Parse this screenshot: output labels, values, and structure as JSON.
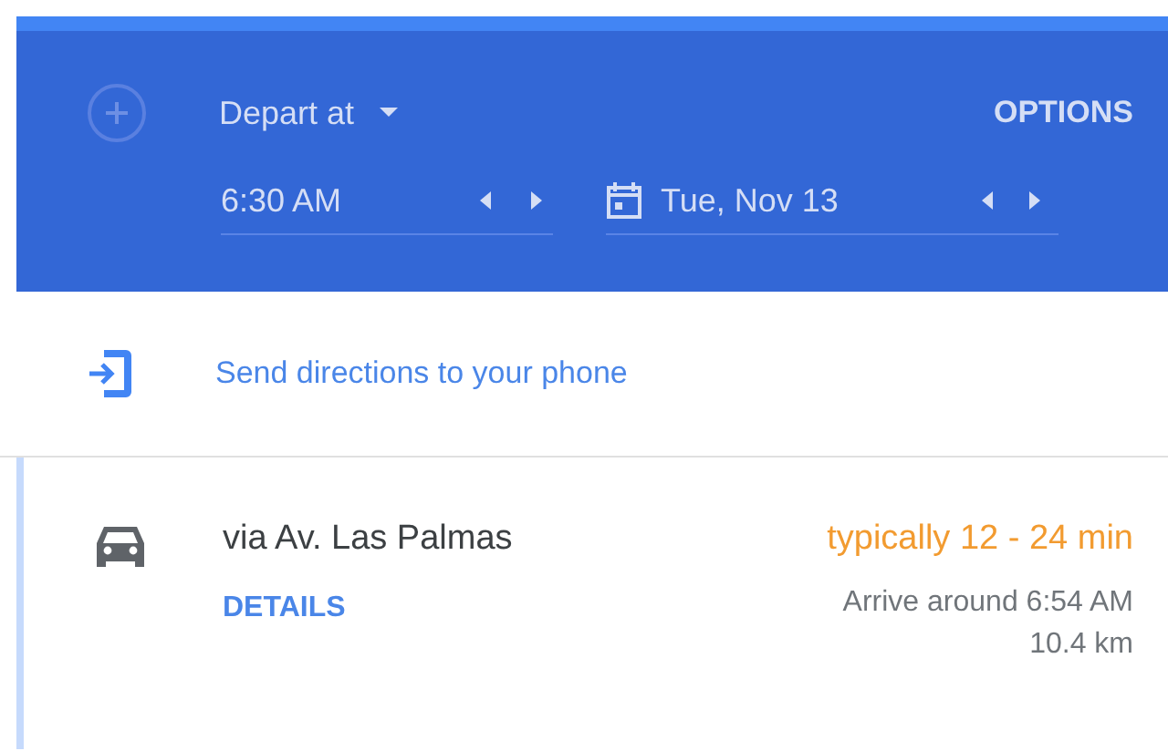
{
  "header": {
    "mode_label": "Depart at",
    "options_label": "OPTIONS",
    "time": "6:30 AM",
    "date": "Tue, Nov 13"
  },
  "send_link": "Send directions to your phone",
  "routes": [
    {
      "name": "via Av. Las Palmas",
      "details_label": "DETAILS",
      "duration": "typically 12 - 24 min",
      "arrival": "Arrive around 6:54 AM",
      "distance": "10.4 km",
      "selected": true
    }
  ]
}
